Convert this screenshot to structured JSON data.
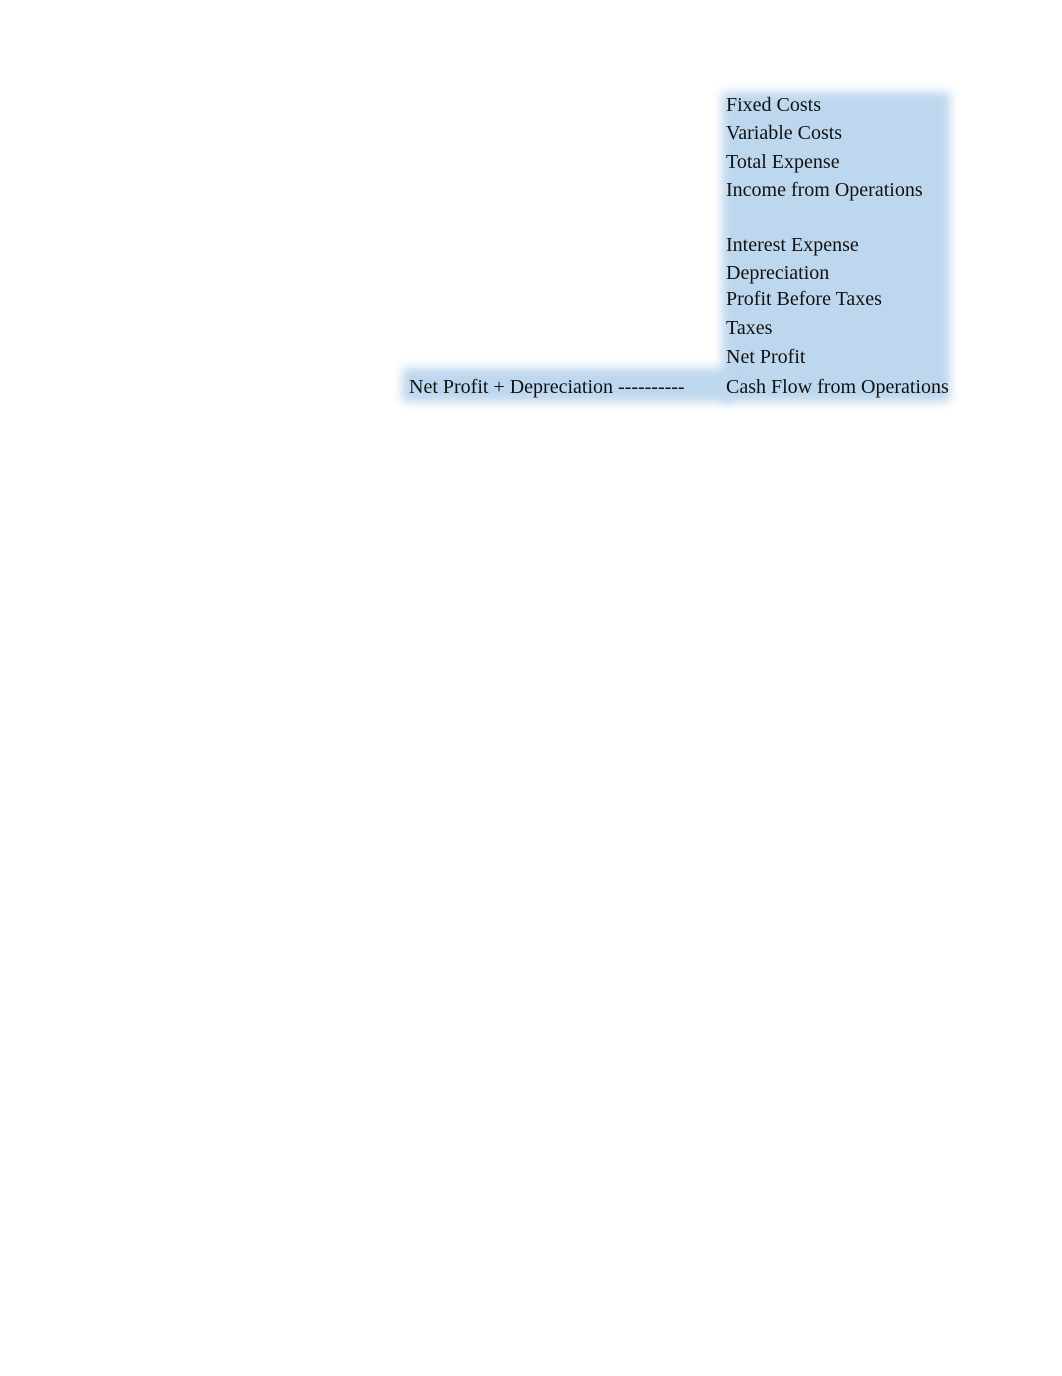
{
  "highlight_color": "#bdd7ee",
  "column_items": [
    "Fixed Costs",
    "Variable Costs",
    "Total Expense",
    "Income from Operations",
    "",
    "Interest Expense",
    "Depreciation",
    "Profit Before Taxes",
    "Taxes",
    "Net Profit",
    "Cash Flow from Operations"
  ],
  "formula_note": "Net Profit + Depreciation ----------"
}
